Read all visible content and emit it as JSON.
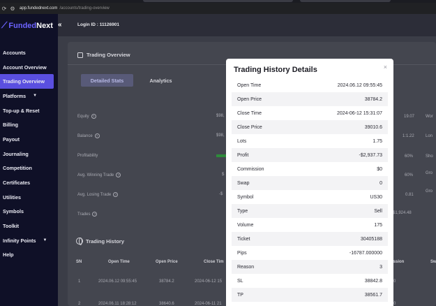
{
  "browser": {
    "host": "app.fundednext.com",
    "path": "/accounts/trading-overview"
  },
  "brand": {
    "name_part1": "Funded",
    "name_part2": "Next",
    "accent": "#6c63ff"
  },
  "sidebar": {
    "items": [
      {
        "label": "Accounts"
      },
      {
        "label": "Account Overview"
      },
      {
        "label": "Trading Overview"
      },
      {
        "label": "Platforms"
      },
      {
        "label": "Top-up & Reset"
      },
      {
        "label": "Billing"
      },
      {
        "label": "Payout"
      },
      {
        "label": "Journaling"
      },
      {
        "label": "Competition"
      },
      {
        "label": "Certificates"
      },
      {
        "label": "Utilities"
      },
      {
        "label": "Symbols"
      },
      {
        "label": "Toolkit"
      },
      {
        "label": "Infinity Points"
      },
      {
        "label": "Help"
      }
    ],
    "active_index": 2
  },
  "header": {
    "login": "Login ID : 11126901"
  },
  "overview": {
    "title": "Trading Overview",
    "tabs": [
      {
        "label": "Detailed Stats"
      },
      {
        "label": "Analytics"
      }
    ],
    "rows": [
      {
        "label": "Equity",
        "value": "$98,"
      },
      {
        "label": "Balance",
        "value": "$98,"
      },
      {
        "label": "Profitability",
        "value": ""
      },
      {
        "label": "Avg. Winning Trade",
        "value": "$"
      },
      {
        "label": "Avg. Losing Trade",
        "value": "-$"
      },
      {
        "label": "Trades",
        "value": ""
      }
    ],
    "right_values": [
      "19.07",
      "1:1.22",
      "60%",
      "60%",
      "0.81",
      "-$1,924.48"
    ],
    "right_labels": [
      "Wor",
      "Lon",
      "Sho",
      "Gro",
      "Gro"
    ]
  },
  "history": {
    "title": "Trading History",
    "columns": [
      "SN",
      "Open Time",
      "Open Price",
      "Close Tim",
      "ission",
      "Sw"
    ],
    "rows": [
      {
        "sn": "1",
        "open_time": "2024.06.12 09:55:45",
        "open_price": "38784.2",
        "close_time": "2024-06-12 15",
        "commission": "0"
      },
      {
        "sn": "2",
        "open_time": "2024.06.11 18:28:12",
        "open_price": "38640.6",
        "close_time": "2024-06-11 21",
        "commission": "0"
      }
    ]
  },
  "modal": {
    "title": "Trading History Details",
    "close": "×",
    "rows": [
      {
        "k": "Open Time",
        "v": "2024.06.12 09:55:45"
      },
      {
        "k": "Open Price",
        "v": "38784.2"
      },
      {
        "k": "Close Time",
        "v": "2024-06-12 15:31:07"
      },
      {
        "k": "Close Price",
        "v": "39010.6"
      },
      {
        "k": "Lots",
        "v": "1.75"
      },
      {
        "k": "Profit",
        "v": "-$2,937.73"
      },
      {
        "k": "Commission",
        "v": "$0"
      },
      {
        "k": "Swap",
        "v": "0"
      },
      {
        "k": "Symbol",
        "v": "US30"
      },
      {
        "k": "Type",
        "v": "Sell"
      },
      {
        "k": "Volume",
        "v": "175"
      },
      {
        "k": "Ticket",
        "v": "30405188"
      },
      {
        "k": "Pips",
        "v": "-16787.000000"
      },
      {
        "k": "Reason",
        "v": "3"
      },
      {
        "k": "SL",
        "v": "38842.8"
      },
      {
        "k": "TP",
        "v": "38561.7"
      }
    ]
  }
}
